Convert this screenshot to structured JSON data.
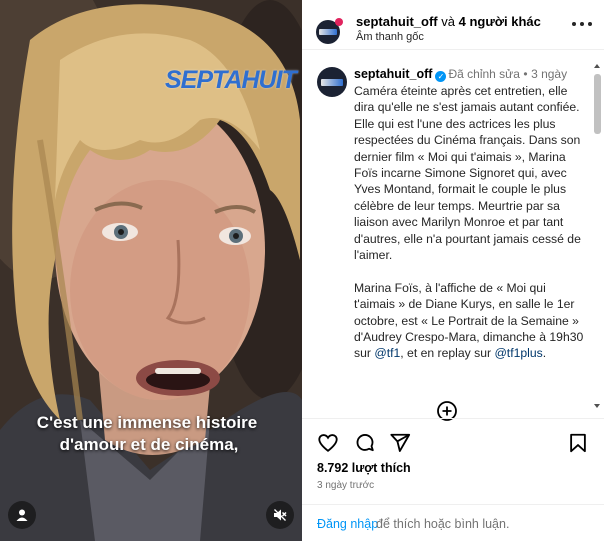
{
  "video": {
    "watermark": "SEPTAHUIT",
    "subtitle_line1": "C'est une immense histoire",
    "subtitle_line2": "d'amour et de cinéma,",
    "user_icon": "person-icon",
    "mute_icon": "speaker-muted-icon"
  },
  "header": {
    "username": "septahuit_off",
    "connector": "và",
    "others": "4 người khác",
    "audio": "Âm thanh gốc",
    "more_icon": "more-dots-icon"
  },
  "caption": {
    "username": "septahuit_off",
    "edited": "Đã chỉnh sửa",
    "separator": "•",
    "time": "3 ngày",
    "paragraph1": "Caméra éteinte après cet entretien, elle dira qu'elle ne s'est jamais autant confiée. Elle qui est l'une des actrices les plus respectées du Cinéma français. Dans son dernier film « Moi qui t'aimais », Marina Foïs incarne Simone Signoret qui, avec Yves Montand, formait le couple le plus célèbre de leur temps. Meurtrie par sa liaison avec Marilyn Monroe et par tant d'autres, elle n'a pourtant jamais cessé de l'aimer.",
    "paragraph2_before": "Marina Foïs, à l'affiche de « Moi qui t'aimais » de Diane Kurys, en salle le 1er octobre, est « Le Portrait de la Semaine » d'Audrey Crespo-Mara, dimanche à 19h30 sur",
    "mention1": "@tf1",
    "paragraph2_middle": ", et en replay sur",
    "mention2": "@tf1plus",
    "paragraph2_end": "."
  },
  "actions": {
    "like_icon": "heart-icon",
    "comment_icon": "comment-icon",
    "share_icon": "send-icon",
    "save_icon": "bookmark-icon",
    "add_icon": "add-circle-icon",
    "likes": "8.792 lượt thích",
    "date": "3 ngày trước"
  },
  "login": {
    "link": "Đăng nhập",
    "rest": "để thích hoặc bình luận."
  },
  "colors": {
    "link_blue": "#0095f6",
    "mention_blue": "#00376b",
    "secondary_text": "#737373",
    "verified": "#0095f6",
    "watermark": "#2f6fd0"
  }
}
